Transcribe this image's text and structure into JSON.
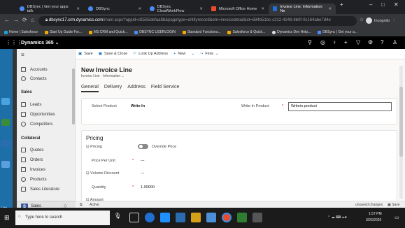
{
  "browser": {
    "tabs": [
      {
        "label": "DBSync | Get your apps talk",
        "color": "#4c8bf5",
        "active": false
      },
      {
        "label": "DBSync",
        "color": "#4c8bf5",
        "active": false
      },
      {
        "label": "DBSync CloudWorkFlow",
        "color": "#4c8bf5",
        "active": false
      },
      {
        "label": "Microsoft Office Home",
        "color": "#e94b2c",
        "active": false
      },
      {
        "label": "Invoice Line: Information: Ne",
        "color": "#1e6fd9",
        "active": true
      }
    ],
    "new_tab": "+",
    "window_controls": [
      "–",
      "□",
      "✕"
    ],
    "url_host": "dbsync17.crm.dynamics.com",
    "url_path": "/main.aspx?appid=d1565defaa8b&pagetype=entityrecord&etn=invoicedetail&id=684b51bc-c312-4248-8b0f-0c164abe7d4e",
    "incognito_label": "Incognito",
    "bookmarks": [
      {
        "label": "Home | Salesforce",
        "color": "#1ea0db"
      },
      {
        "label": "Start Up Guide For...",
        "color": "#f2a900"
      },
      {
        "label": "MS CRM and Quick...",
        "color": "#f2a900"
      },
      {
        "label": "DBSYNC USERLOGIN",
        "color": "#4c8bf5"
      },
      {
        "label": "Standard Functions...",
        "color": "#f2a900"
      },
      {
        "label": "Salesforce & Quick...",
        "color": "#f2a900"
      },
      {
        "label": "Dynamics Dev Help...",
        "color": "#ddd"
      },
      {
        "label": "DBSync | Get your a...",
        "color": "#4c8bf5"
      }
    ]
  },
  "app": {
    "brand": "Dynamics 365",
    "brand_caret": "⌄",
    "header_icons": [
      "search-icon",
      "target-icon",
      "lightbulb-icon",
      "plus-icon",
      "filter-icon",
      "gear-icon",
      "help-icon",
      "user-icon"
    ]
  },
  "nav": {
    "items_top": [
      {
        "label": "Accounts",
        "icon": "accounts-icon"
      },
      {
        "label": "Contacts",
        "icon": "contacts-icon"
      }
    ],
    "group_sales": "Sales",
    "items_sales": [
      {
        "label": "Leads",
        "icon": "leads-icon"
      },
      {
        "label": "Opportunities",
        "icon": "opportunities-icon"
      },
      {
        "label": "Competitors",
        "icon": "competitors-icon"
      }
    ],
    "group_collateral": "Collateral",
    "items_collateral": [
      {
        "label": "Quotes",
        "icon": "quotes-icon"
      },
      {
        "label": "Orders",
        "icon": "orders-icon"
      },
      {
        "label": "Invoices",
        "icon": "invoices-icon"
      },
      {
        "label": "Products",
        "icon": "products-icon"
      },
      {
        "label": "Sales Literature",
        "icon": "literature-icon"
      }
    ],
    "area": {
      "badge": "S",
      "label": "Sales",
      "caret": "◇"
    }
  },
  "commands": {
    "save": "Save",
    "save_close": "Save & Close",
    "lookup": "Look Up Address",
    "new": "New",
    "flow": "Flow"
  },
  "record": {
    "title": "New Invoice Line",
    "subtitle": "Invoice Line · Information",
    "tabs": [
      "General",
      "Delivery",
      "Address",
      "Field Service"
    ],
    "active_tab": "General"
  },
  "product_section": {
    "select_product_label": "Select Product",
    "select_product_value": "Write In",
    "writein_label": "Write-In Product",
    "writein_value": "Writein product"
  },
  "pricing_section": {
    "title": "Pricing",
    "pricing_label": "Pricing",
    "override_label": "Override Price",
    "price_per_unit_label": "Price Per Unit",
    "price_per_unit_value": "---",
    "volume_discount_label": "Volume Discount",
    "volume_discount_value": "---",
    "quantity_label": "Quantity",
    "quantity_value": "1.00000",
    "amount_label": "Amount",
    "required_mark": "*"
  },
  "status": {
    "state": "Active",
    "unsaved": "unsaved changes",
    "save": "Save"
  },
  "taskbar": {
    "search_placeholder": "Type here to search",
    "time": "1:57 PM",
    "date": "3/26/2020",
    "desktop_label": "1 Itel"
  }
}
